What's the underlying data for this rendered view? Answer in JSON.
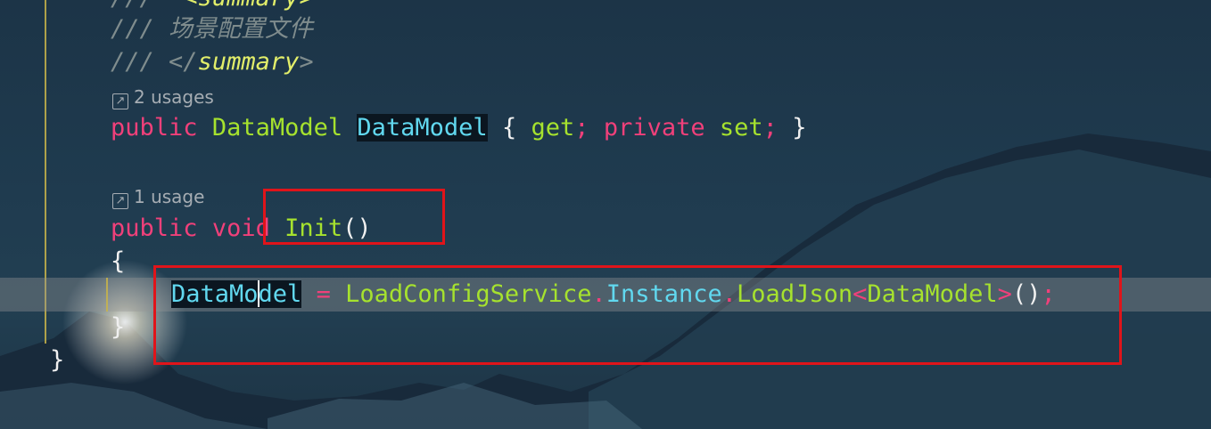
{
  "editor": {
    "doc_comment": {
      "summary_open": "<summary>",
      "comment_slashes": "///",
      "comment_text": "场景配置文件",
      "summary_close_open": "</",
      "summary_close_word": "summary",
      "summary_close_end": ">"
    },
    "hint_property": {
      "icon": "arrow-up-right-icon",
      "text": "2 usages"
    },
    "property_line": {
      "kw_public": "public",
      "type": "DataModel",
      "name": "DataModel",
      "brace_open": "{",
      "get": "get",
      "semicolon1": ";",
      "kw_private": "private",
      "set": "set",
      "semicolon2": ";",
      "brace_close": "}"
    },
    "hint_method": {
      "icon": "arrow-up-right-icon",
      "text": "1 usage"
    },
    "method_line": {
      "kw_public": "public",
      "kw_void_a": "voi",
      "kw_void_b": "d",
      "name": "Init",
      "parens": "()"
    },
    "open_brace": "{",
    "statement": {
      "target_a": "DataMo",
      "target_b": "del",
      "assign": "=",
      "service": "LoadConfigService",
      "dot1": ".",
      "instance": "Instance",
      "dot2": ".",
      "method": "LoadJson",
      "lt": "<",
      "generic": "DataModel",
      "gt": ">",
      "call": "()",
      "semicolon": ";"
    },
    "close_brace_inner": "}",
    "close_brace_outer": "}"
  },
  "colors": {
    "keyword": "#f0407a",
    "type": "#a6e22e",
    "property": "#61d8ef",
    "comment": "#7f8c8d",
    "highlight_box": "#e0141a",
    "indent_guide": "#c8b44a"
  }
}
